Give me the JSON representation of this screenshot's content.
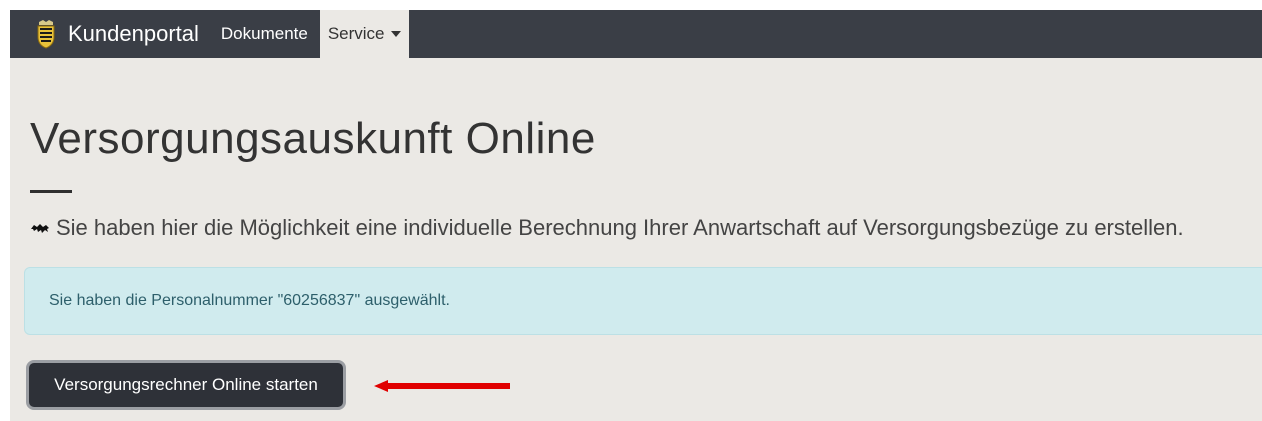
{
  "navbar": {
    "brand_label": "Kundenportal",
    "logo_icon": "coat-of-arms-icon",
    "items": [
      {
        "label": "Dokumente",
        "active": false
      },
      {
        "label": "Service",
        "active": true,
        "has_dropdown": true
      }
    ]
  },
  "main": {
    "title": "Versorgungsauskunft Online",
    "intro_icon": "lion-icon",
    "intro_text": "Sie haben hier die Möglichkeit eine individuelle Berechnung Ihrer Anwartschaft auf Versorgungsbezüge zu erstellen.",
    "alert_text": "Sie haben die Personalnummer \"60256837\" ausgewählt.",
    "start_button_label": "Versorgungsrechner Online starten"
  },
  "colors": {
    "navbar_bg": "#3a3e46",
    "page_bg": "#ebe9e5",
    "alert_bg": "#d0ebee",
    "alert_text": "#2d5f6b",
    "button_bg": "#2e3138",
    "arrow": "#e00000"
  },
  "annotation": {
    "arrow_icon": "red-arrow-icon"
  }
}
